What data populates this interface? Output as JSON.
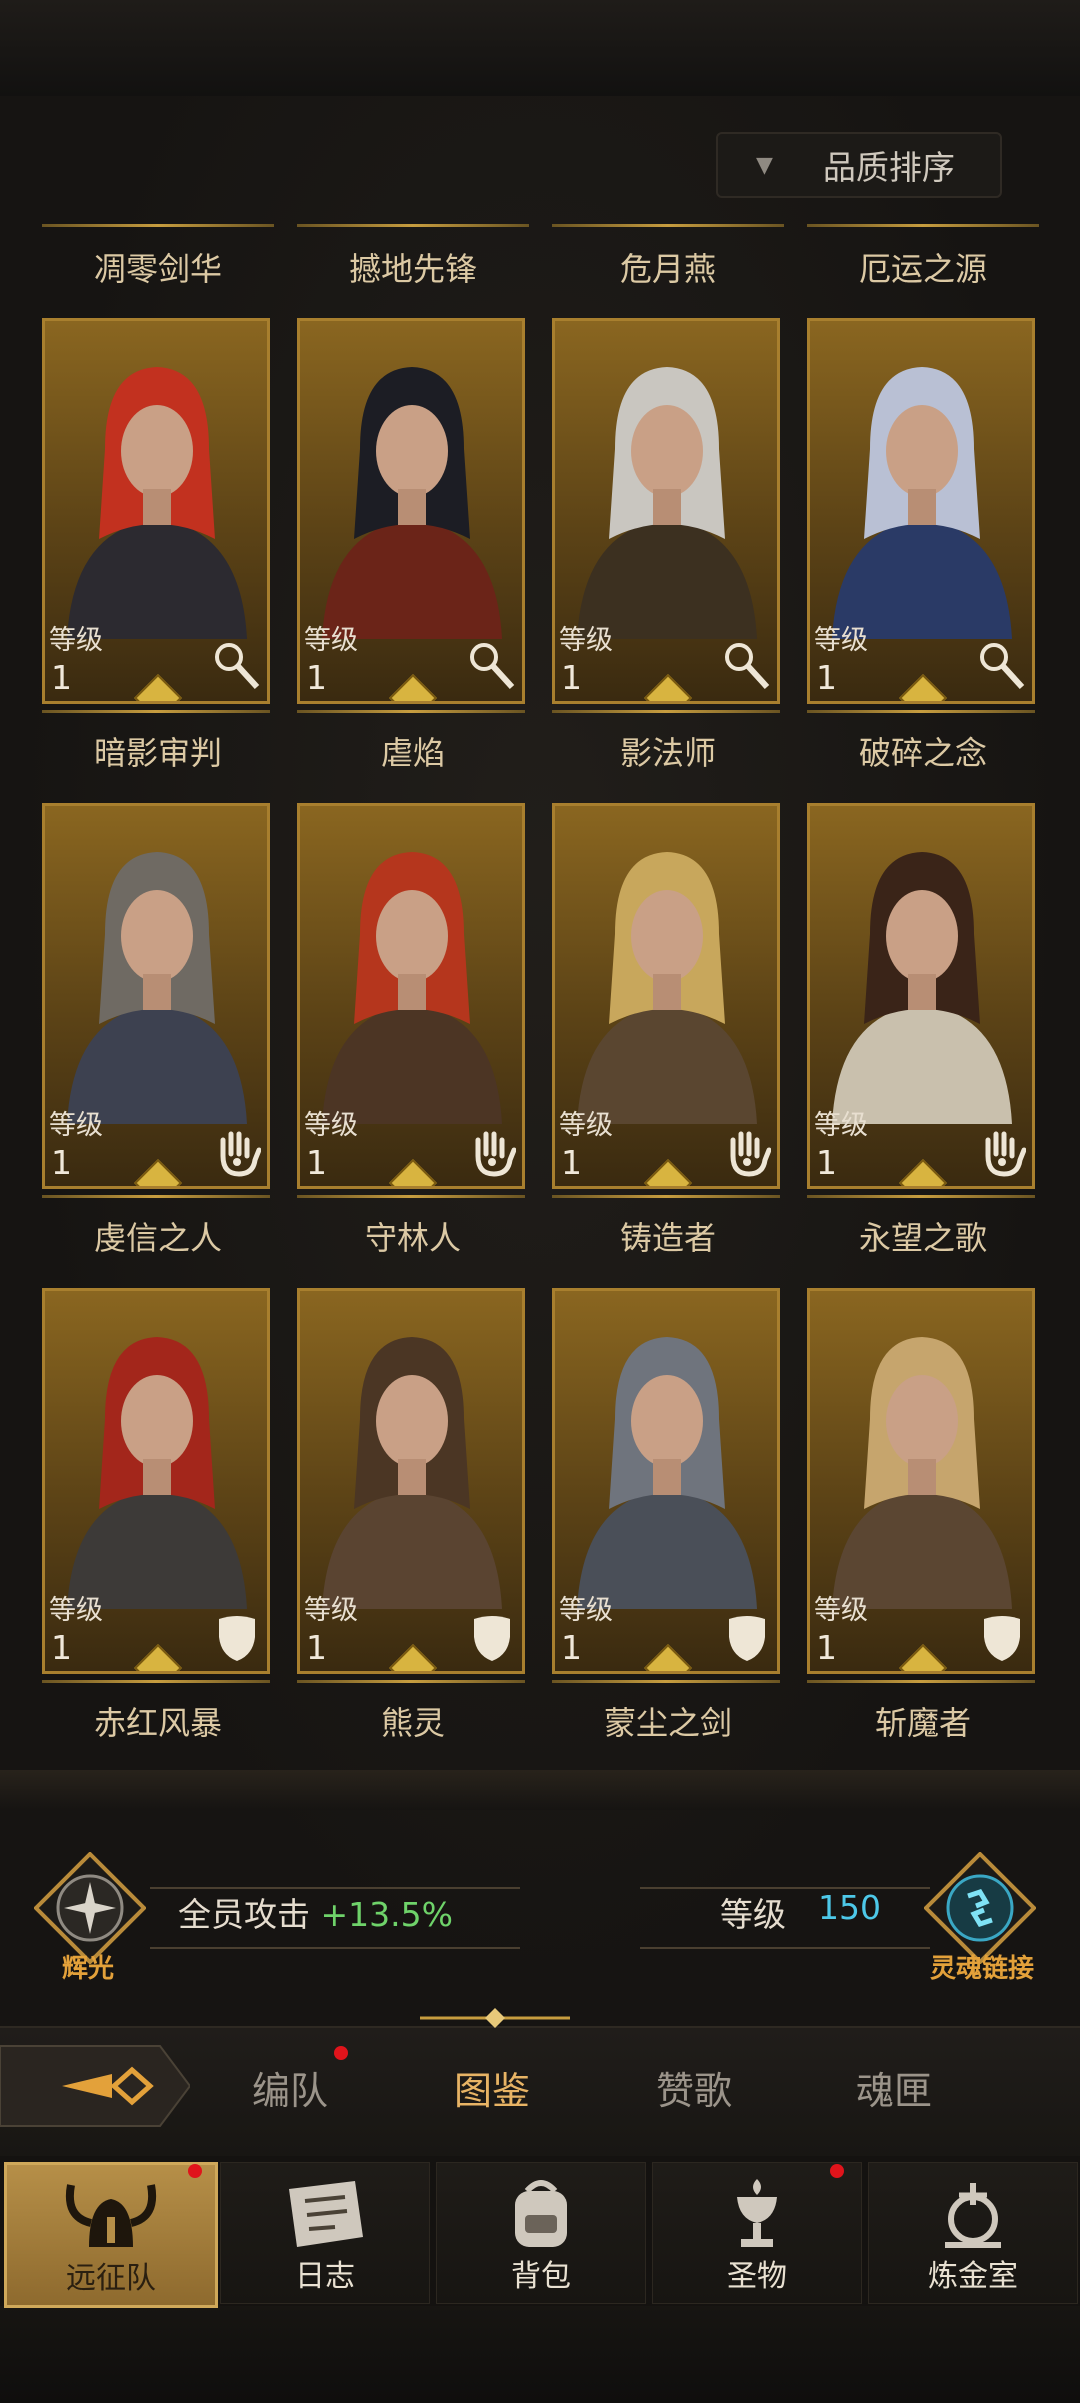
{
  "sort": {
    "label": "品质排序",
    "icon": "dropdown-triangle-icon"
  },
  "top_names": [
    "凋零剑华",
    "撼地先锋",
    "危月燕",
    "厄运之源"
  ],
  "rows": [
    {
      "role_icon": "wand-icon",
      "cards": [
        {
          "name": "暗影审判",
          "level_label": "等级",
          "level": "1",
          "hair": "#c2311f",
          "outfit": "#2c2a30"
        },
        {
          "name": "虐焰",
          "level_label": "等级",
          "level": "1",
          "hair": "#1c1d24",
          "outfit": "#6b2418"
        },
        {
          "name": "影法师",
          "level_label": "等级",
          "level": "1",
          "hair": "#c9c6c0",
          "outfit": "#3c3020"
        },
        {
          "name": "破碎之念",
          "level_label": "等级",
          "level": "1",
          "hair": "#b9c0d4",
          "outfit": "#2a3a66"
        }
      ]
    },
    {
      "role_icon": "hand-icon",
      "cards": [
        {
          "name": "虔信之人",
          "level_label": "等级",
          "level": "1",
          "hair": "#6f6a63",
          "outfit": "#3d4150"
        },
        {
          "name": "守林人",
          "level_label": "等级",
          "level": "1",
          "hair": "#b5361d",
          "outfit": "#4c3524"
        },
        {
          "name": "铸造者",
          "level_label": "等级",
          "level": "1",
          "hair": "#c8a75c",
          "outfit": "#5a4630"
        },
        {
          "name": "永望之歌",
          "level_label": "等级",
          "level": "1",
          "hair": "#3a2418",
          "outfit": "#c9c0ad"
        }
      ]
    },
    {
      "role_icon": "shield-icon",
      "cards": [
        {
          "name": "赤红风暴",
          "level_label": "等级",
          "level": "1",
          "hair": "#a3261b",
          "outfit": "#3d3a38"
        },
        {
          "name": "熊灵",
          "level_label": "等级",
          "level": "1",
          "hair": "#4b3624",
          "outfit": "#5a4431"
        },
        {
          "name": "蒙尘之剑",
          "level_label": "等级",
          "level": "1",
          "hair": "#6f747d",
          "outfit": "#4a4f58"
        },
        {
          "name": "斩魔者",
          "level_label": "等级",
          "level": "1",
          "hair": "#c6a56d",
          "outfit": "#5b4632"
        }
      ]
    }
  ],
  "bonus": {
    "label": "全员攻击",
    "value": "+13.5%",
    "left_emblem": "辉光",
    "level_label": "等级",
    "level_value": "150",
    "right_emblem": "灵魂链接"
  },
  "tabs": [
    {
      "label": "编队",
      "active": false,
      "badge": true
    },
    {
      "label": "图鉴",
      "active": true,
      "badge": false
    },
    {
      "label": "赞歌",
      "active": false,
      "badge": false
    },
    {
      "label": "魂匣",
      "active": false,
      "badge": false
    }
  ],
  "nav": [
    {
      "label": "远征队",
      "icon": "horned-helmet-icon",
      "active": true,
      "badge": true
    },
    {
      "label": "日志",
      "icon": "scroll-icon",
      "active": false,
      "badge": false
    },
    {
      "label": "背包",
      "icon": "backpack-icon",
      "active": false,
      "badge": false
    },
    {
      "label": "圣物",
      "icon": "chalice-icon",
      "active": false,
      "badge": true
    },
    {
      "label": "炼金室",
      "icon": "alchemy-icon",
      "active": false,
      "badge": false
    }
  ],
  "colors": {
    "gold": "#c79d3f",
    "active_tab": "#e8b465",
    "bonus_green": "#6fd36a",
    "level_cyan": "#4dc8e8",
    "badge_red": "#e0141b"
  }
}
